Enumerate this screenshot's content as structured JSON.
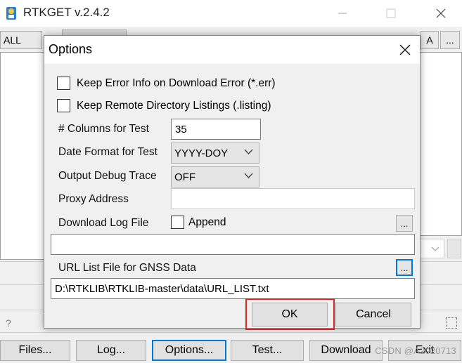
{
  "window": {
    "title": "RTKGET v.2.4.2"
  },
  "toolbar": {
    "all_label": "ALL",
    "a_label": "A",
    "more_label": "..."
  },
  "status": {
    "help_mark": "?"
  },
  "bottom_buttons": {
    "files": "Files...",
    "log": "Log...",
    "options": "Options...",
    "test": "Test...",
    "download": "Download",
    "exit": "Exit"
  },
  "watermark": "CSDN @A2020713",
  "dialog": {
    "title": "Options",
    "keep_error_label": "Keep Error Info on Download Error (*.err)",
    "keep_listing_label": "Keep Remote Directory Listings (.listing)",
    "columns_label": "# Columns for Test",
    "columns_value": "35",
    "date_format_label": "Date Format for Test",
    "date_format_value": "YYYY-DOY",
    "debug_trace_label": "Output Debug Trace",
    "debug_trace_value": "OFF",
    "proxy_label": "Proxy Address",
    "proxy_value": "",
    "log_file_label": "Download Log File",
    "append_label": "Append",
    "log_file_value": "",
    "url_list_label": "URL List File for GNSS Data",
    "url_list_value": "D:\\RTKLIB\\RTKLIB-master\\data\\URL_LIST.txt",
    "dots": "...",
    "ok_label": "OK",
    "cancel_label": "Cancel"
  }
}
